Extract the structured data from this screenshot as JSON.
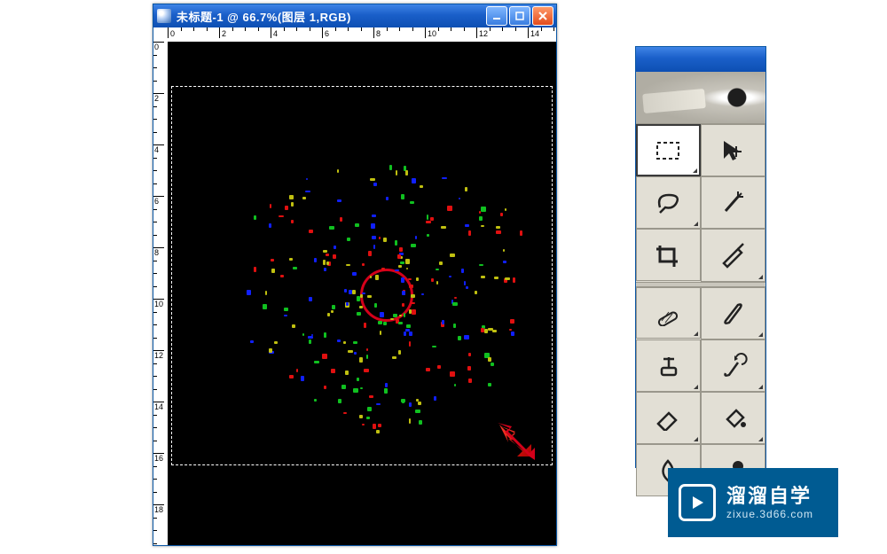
{
  "document": {
    "title": "未标题-1 @ 66.7%(图层 1,RGB)",
    "ruler_labels_h": [
      0,
      2,
      4,
      6,
      8,
      10,
      12,
      14
    ],
    "ruler_labels_v": [
      0,
      2,
      4,
      6,
      8,
      10,
      12,
      14,
      16,
      18
    ]
  },
  "window_controls": {
    "minimize": "minimize",
    "maximize": "maximize",
    "close": "close"
  },
  "toolbox": {
    "tools": [
      {
        "id": "rectangular-marquee-tool",
        "selected": true,
        "submenu": true
      },
      {
        "id": "move-tool",
        "selected": false,
        "submenu": false
      },
      {
        "id": "lasso-tool",
        "selected": false,
        "submenu": true
      },
      {
        "id": "magic-wand-tool",
        "selected": false,
        "submenu": false
      },
      {
        "id": "crop-tool",
        "selected": false,
        "submenu": false
      },
      {
        "id": "slice-tool",
        "selected": false,
        "submenu": true
      },
      {
        "id": "healing-brush-tool",
        "selected": false,
        "submenu": true
      },
      {
        "id": "brush-tool",
        "selected": false,
        "submenu": true
      },
      {
        "id": "clone-stamp-tool",
        "selected": false,
        "submenu": true
      },
      {
        "id": "history-brush-tool",
        "selected": false,
        "submenu": true
      },
      {
        "id": "eraser-tool",
        "selected": false,
        "submenu": true
      },
      {
        "id": "paint-bucket-tool",
        "selected": false,
        "submenu": true
      },
      {
        "id": "blur-tool",
        "selected": false,
        "submenu": true
      },
      {
        "id": "dodge-tool",
        "selected": false,
        "submenu": true
      }
    ]
  },
  "watermark": {
    "brand": "溜溜自学",
    "url": "zixue.3d66.com"
  },
  "annotations": {
    "circle": "highlight-circle",
    "arrow": "highlight-arrow"
  },
  "colors": {
    "titlebar": "#1a5fc9",
    "close": "#e24b1d",
    "toolbox_bg": "#e2dfd5",
    "watermark_bg": "#005b92",
    "annotation_red": "#d4001a"
  }
}
